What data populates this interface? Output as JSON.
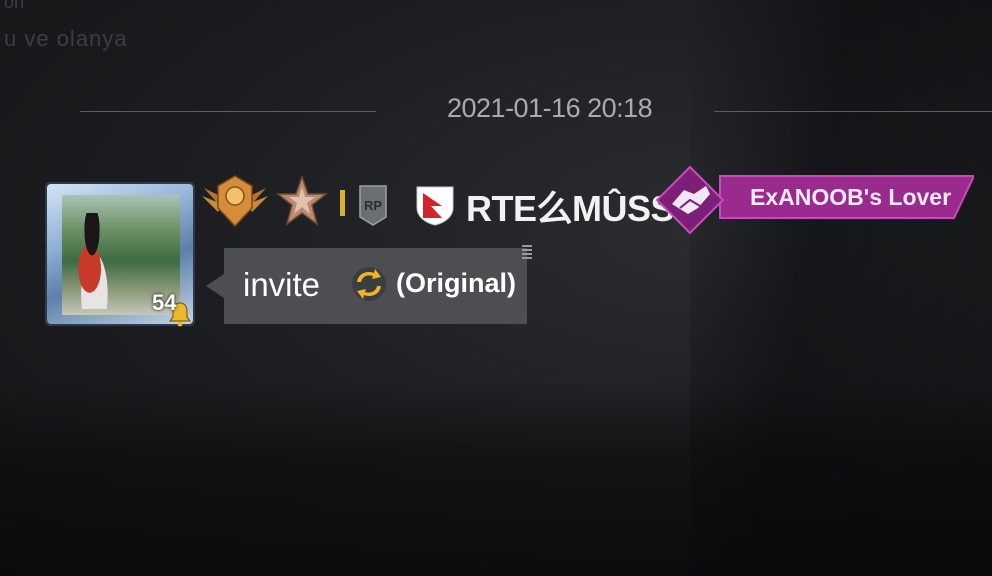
{
  "chat": {
    "faded_line_top": "on",
    "faded_line": "u ve olanya",
    "timestamp": "2021-01-16 20:18"
  },
  "player": {
    "level": "54",
    "rp_badge": "RP",
    "name": "RTE么MÛSSÎ",
    "relation": "ExANOOB's Lover"
  },
  "message": {
    "text": "invite",
    "suffix": "(Original)"
  },
  "icons": {
    "tier_badge": "gold-winged-tier-icon",
    "rank_badge": "bronze-star-rank-icon",
    "rp_badge": "rp-icon",
    "flag": "nepal-flag-icon",
    "relation": "handshake-icon",
    "refresh": "refresh-icon",
    "level_bell": "bell-icon"
  },
  "colors": {
    "relation_tag": "#9b2a8f",
    "invite_bubble": "#4c4e52",
    "accent_gold": "#d9b12a"
  }
}
